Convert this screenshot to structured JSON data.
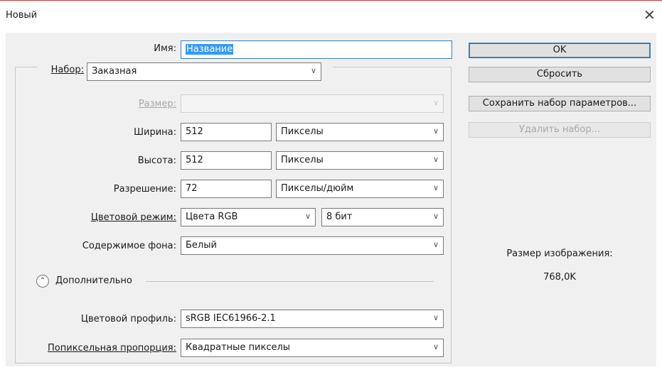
{
  "window": {
    "title": "Новый",
    "close_glyph": "✕"
  },
  "name": {
    "label": "Имя:",
    "value": "Название"
  },
  "preset": {
    "label": "Набор:",
    "value": "Заказная"
  },
  "size": {
    "label": "Размер:",
    "value": ""
  },
  "width": {
    "label": "Ширина:",
    "value": "512",
    "unit": "Пикселы"
  },
  "height": {
    "label": "Высота:",
    "value": "512",
    "unit": "Пикселы"
  },
  "resolution": {
    "label": "Разрешение:",
    "value": "72",
    "unit": "Пикселы/дюйм"
  },
  "color_mode": {
    "label": "Цветовой режим:",
    "value": "Цвета RGB",
    "depth": "8 бит"
  },
  "background": {
    "label": "Содержимое фона:",
    "value": "Белый"
  },
  "advanced": {
    "label": "Дополнительно",
    "toggle_glyph": "⌃"
  },
  "color_profile": {
    "label": "Цветовой профиль:",
    "value": "sRGB IEC61966-2.1"
  },
  "pixel_aspect": {
    "label": "Попиксельная пропорция:",
    "value": "Квадратные пикселы"
  },
  "buttons": {
    "ok": "OK",
    "reset": "Сбросить",
    "save_preset": "Сохранить набор параметров...",
    "delete_preset": "Удалить набор..."
  },
  "image_size": {
    "label": "Размер изображения:",
    "value": "768,0K"
  },
  "icons": {
    "dropdown": "chevron-down-icon",
    "close": "close-icon",
    "collapse": "collapse-up-icon"
  },
  "colors": {
    "accent": "#3c7fb1",
    "selection": "#3399ff",
    "title_line": "#c0392b"
  }
}
